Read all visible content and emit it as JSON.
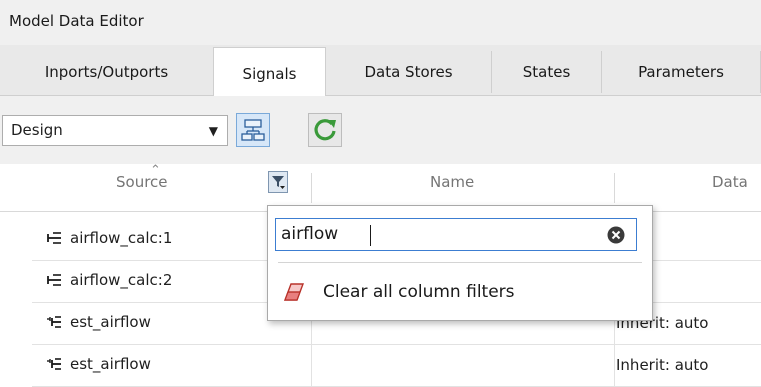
{
  "window": {
    "title": "Model Data Editor"
  },
  "tabs": [
    {
      "label": "Inports/Outports"
    },
    {
      "label": "Signals"
    },
    {
      "label": "Data Stores"
    },
    {
      "label": "States"
    },
    {
      "label": "Parameters"
    }
  ],
  "active_tab": "Signals",
  "toolbar": {
    "view_select_value": "Design",
    "hierarchy_button_icon": "hierarchy-icon",
    "refresh_button_icon": "refresh-icon"
  },
  "table": {
    "columns": [
      {
        "label": "Source",
        "sorted": true,
        "has_filter": true
      },
      {
        "label": "Name"
      },
      {
        "label": "Data"
      }
    ],
    "rows": [
      {
        "source": "airflow_calc:1",
        "source_icon": "signal-output-port-icon",
        "name": "",
        "data": ""
      },
      {
        "source": "airflow_calc:2",
        "source_icon": "signal-output-port-icon",
        "name": "",
        "data": ""
      },
      {
        "source": "est_airflow",
        "source_icon": "signal-input-port-icon",
        "name": "",
        "data": "Inherit: auto"
      },
      {
        "source": "est_airflow",
        "source_icon": "signal-input-port-icon",
        "name": "",
        "data": "Inherit: auto"
      }
    ]
  },
  "filter_popup": {
    "input_value": "airflow",
    "clear_input_icon": "clear-x-icon",
    "clear_all_label": "Clear all column filters",
    "clear_all_icon": "eraser-icon"
  },
  "colors": {
    "accent": "#3c7dd1",
    "eraser": "#c0392b",
    "toolbar_bg": "#f0f0f0"
  }
}
